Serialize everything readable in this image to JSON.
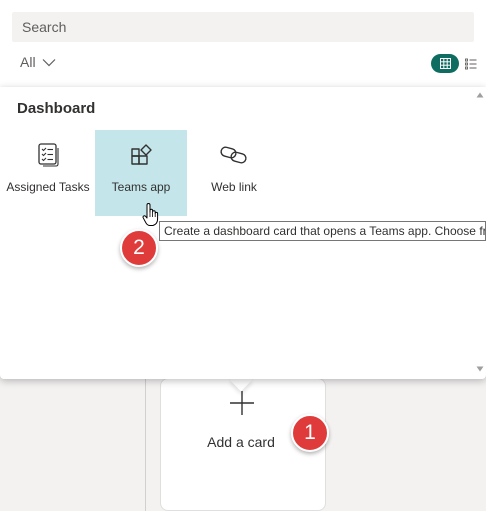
{
  "search": {
    "placeholder": "Search"
  },
  "filter": {
    "label": "All"
  },
  "view_toggle": {
    "active": "grid",
    "accent_color": "#0f6c61"
  },
  "popup": {
    "title": "Dashboard",
    "tiles": [
      {
        "label": "Assigned Tasks",
        "icon": "task-list-icon"
      },
      {
        "label": "Teams app",
        "icon": "apps-add-icon",
        "selected": true,
        "highlight_color": "#c4e6ea"
      },
      {
        "label": "Web link",
        "icon": "link-icon"
      }
    ]
  },
  "tooltip": {
    "text": "Create a dashboard card that opens a Teams app. Choose fro"
  },
  "add_card": {
    "label": "Add a card"
  },
  "annotations": {
    "badge_1": "1",
    "badge_2": "2",
    "badge_color": "#e03b3b"
  }
}
